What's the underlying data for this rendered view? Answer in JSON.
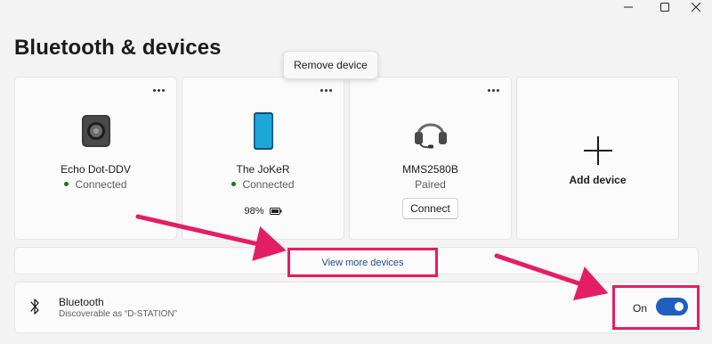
{
  "window": {
    "controls": [
      "minimize-icon",
      "maximize-icon",
      "close-icon"
    ]
  },
  "page": {
    "title": "Bluetooth & devices"
  },
  "tooltip": {
    "text": "Remove device"
  },
  "devices": [
    {
      "name": "Echo Dot-DDV",
      "status": "Connected",
      "icon": "speaker-icon"
    },
    {
      "name": "The JoKeR",
      "status": "Connected",
      "battery": "98%",
      "icon": "phone-icon"
    },
    {
      "name": "MMS2580B",
      "status": "Paired",
      "action": "Connect",
      "icon": "headset-icon"
    }
  ],
  "add_device": {
    "label": "Add device",
    "icon": "plus-icon"
  },
  "view_more": {
    "label": "View more devices"
  },
  "bluetooth": {
    "title": "Bluetooth",
    "subtitle": "Discoverable as “D-STATION”",
    "toggle_label": "On",
    "enabled": true,
    "icon": "bluetooth-icon"
  },
  "colors": {
    "highlight": "#e41e63",
    "accent": "#1f5fbf",
    "connected_dot": "#107c10"
  }
}
